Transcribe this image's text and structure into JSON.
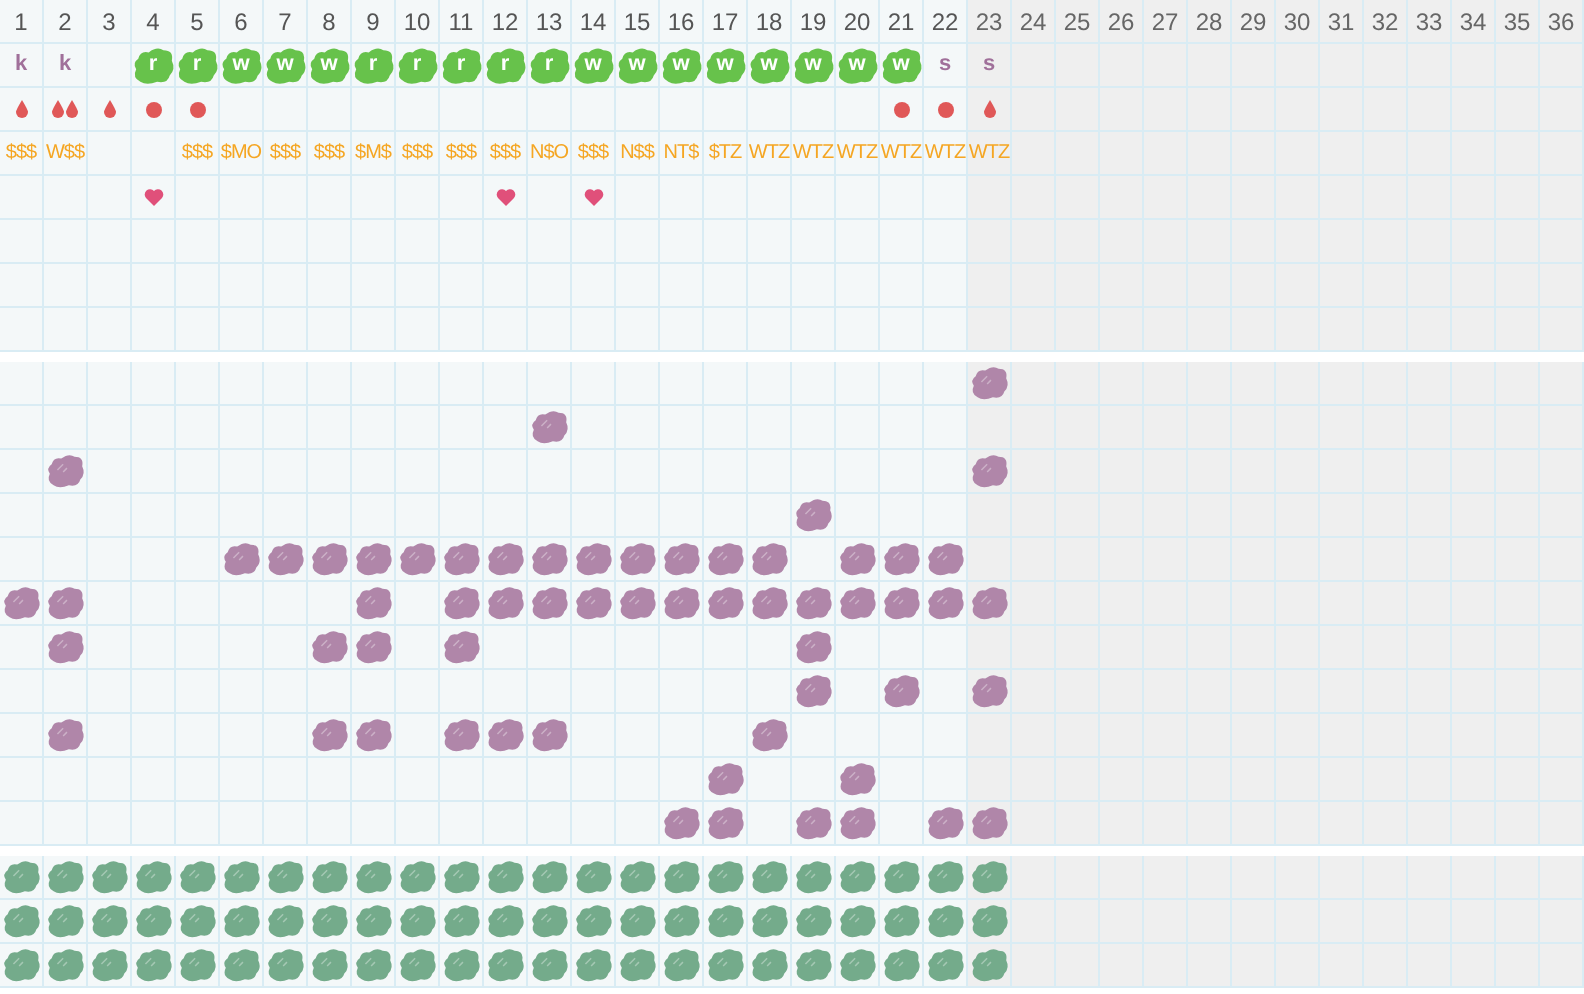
{
  "columns": [
    {
      "label": "1",
      "greyed": false
    },
    {
      "label": "2",
      "greyed": false
    },
    {
      "label": "3",
      "greyed": false
    },
    {
      "label": "4",
      "greyed": false
    },
    {
      "label": "5",
      "greyed": false
    },
    {
      "label": "6",
      "greyed": false
    },
    {
      "label": "7",
      "greyed": false
    },
    {
      "label": "8",
      "greyed": false
    },
    {
      "label": "9",
      "greyed": false
    },
    {
      "label": "10",
      "greyed": false
    },
    {
      "label": "11",
      "greyed": false
    },
    {
      "label": "12",
      "greyed": false
    },
    {
      "label": "13",
      "greyed": false
    },
    {
      "label": "14",
      "greyed": false
    },
    {
      "label": "15",
      "greyed": false
    },
    {
      "label": "16",
      "greyed": false
    },
    {
      "label": "17",
      "greyed": false
    },
    {
      "label": "18",
      "greyed": false
    },
    {
      "label": "19",
      "greyed": false
    },
    {
      "label": "20",
      "greyed": false
    },
    {
      "label": "21",
      "greyed": false
    },
    {
      "label": "22",
      "greyed": false
    },
    {
      "label": "23",
      "greyed": true
    },
    {
      "label": "24",
      "greyed": true
    },
    {
      "label": "25",
      "greyed": true
    },
    {
      "label": "26",
      "greyed": true
    },
    {
      "label": "27",
      "greyed": true
    },
    {
      "label": "28",
      "greyed": true
    },
    {
      "label": "29",
      "greyed": true
    },
    {
      "label": "30",
      "greyed": true
    },
    {
      "label": "31",
      "greyed": true
    },
    {
      "label": "32",
      "greyed": true
    },
    {
      "label": "33",
      "greyed": true
    },
    {
      "label": "34",
      "greyed": true
    },
    {
      "label": "35",
      "greyed": true
    },
    {
      "label": "36",
      "greyed": true
    }
  ],
  "tracks": [
    {
      "tag": {
        "text": "k",
        "kind": "plain"
      },
      "marker": {
        "kind": "drop"
      },
      "code": "$$$",
      "heart": false
    },
    {
      "tag": {
        "text": "k",
        "kind": "plain"
      },
      "marker": {
        "kind": "double_drop"
      },
      "code": "W$$",
      "heart": false
    },
    {
      "marker": {
        "kind": "drop"
      },
      "heart": false
    },
    {
      "tag": {
        "text": "r",
        "kind": "badge"
      },
      "marker": {
        "kind": "dot"
      },
      "heart": true
    },
    {
      "tag": {
        "text": "r",
        "kind": "badge"
      },
      "marker": {
        "kind": "dot"
      },
      "code": "$$$",
      "heart": false
    },
    {
      "tag": {
        "text": "w",
        "kind": "badge"
      },
      "code": "$MO",
      "heart": false
    },
    {
      "tag": {
        "text": "w",
        "kind": "badge"
      },
      "code": "$$$",
      "heart": false
    },
    {
      "tag": {
        "text": "w",
        "kind": "badge"
      },
      "code": "$$$",
      "heart": false
    },
    {
      "tag": {
        "text": "r",
        "kind": "badge"
      },
      "code": "$M$",
      "heart": false
    },
    {
      "tag": {
        "text": "r",
        "kind": "badge"
      },
      "code": "$$$",
      "heart": false
    },
    {
      "tag": {
        "text": "r",
        "kind": "badge"
      },
      "code": "$$$",
      "heart": false
    },
    {
      "tag": {
        "text": "r",
        "kind": "badge"
      },
      "code": "$$$",
      "heart": true
    },
    {
      "tag": {
        "text": "r",
        "kind": "badge"
      },
      "code": "N$O",
      "heart": false
    },
    {
      "tag": {
        "text": "w",
        "kind": "badge"
      },
      "code": "$$$",
      "heart": true
    },
    {
      "tag": {
        "text": "w",
        "kind": "badge"
      },
      "code": "N$$",
      "heart": false
    },
    {
      "tag": {
        "text": "w",
        "kind": "badge"
      },
      "code": "NT$",
      "heart": false
    },
    {
      "tag": {
        "text": "w",
        "kind": "badge"
      },
      "code": "$TZ",
      "heart": false
    },
    {
      "tag": {
        "text": "w",
        "kind": "badge"
      },
      "code": "WTZ",
      "heart": false
    },
    {
      "tag": {
        "text": "w",
        "kind": "badge"
      },
      "code": "WTZ",
      "heart": false
    },
    {
      "tag": {
        "text": "w",
        "kind": "badge"
      },
      "code": "WTZ",
      "heart": false
    },
    {
      "tag": {
        "text": "w",
        "kind": "badge"
      },
      "marker": {
        "kind": "dot"
      },
      "code": "WTZ",
      "heart": false
    },
    {
      "tag": {
        "text": "s",
        "kind": "plain"
      },
      "marker": {
        "kind": "dot"
      },
      "code": "WTZ",
      "heart": false
    },
    {
      "tag": {
        "text": "s",
        "kind": "plain"
      },
      "marker": {
        "kind": "drop"
      },
      "code": "WTZ",
      "heart": false
    }
  ],
  "middle_rows": [
    {
      "cells": [
        false,
        false,
        false,
        false,
        false,
        false,
        false,
        false,
        false,
        false,
        false,
        false,
        false,
        false,
        false,
        false,
        false,
        false,
        false,
        false,
        false,
        false,
        true
      ]
    },
    {
      "cells": [
        false,
        false,
        false,
        false,
        false,
        false,
        false,
        false,
        false,
        false,
        false,
        false,
        true,
        false,
        false,
        false,
        false,
        false,
        false,
        false,
        false,
        false,
        false
      ]
    },
    {
      "cells": [
        false,
        true,
        false,
        false,
        false,
        false,
        false,
        false,
        false,
        false,
        false,
        false,
        false,
        false,
        false,
        false,
        false,
        false,
        false,
        false,
        false,
        false,
        true
      ]
    },
    {
      "cells": [
        false,
        false,
        false,
        false,
        false,
        false,
        false,
        false,
        false,
        false,
        false,
        false,
        false,
        false,
        false,
        false,
        false,
        false,
        true,
        false,
        false,
        false,
        false
      ]
    },
    {
      "cells": [
        false,
        false,
        false,
        false,
        false,
        true,
        true,
        true,
        true,
        true,
        true,
        true,
        true,
        true,
        true,
        true,
        true,
        true,
        false,
        true,
        true,
        true,
        false
      ]
    },
    {
      "cells": [
        true,
        true,
        false,
        false,
        false,
        false,
        false,
        false,
        true,
        false,
        true,
        true,
        true,
        true,
        true,
        true,
        true,
        true,
        true,
        true,
        true,
        true,
        true
      ]
    },
    {
      "cells": [
        false,
        true,
        false,
        false,
        false,
        false,
        false,
        true,
        true,
        false,
        true,
        false,
        false,
        false,
        false,
        false,
        false,
        false,
        true,
        false,
        false,
        false,
        false
      ]
    },
    {
      "cells": [
        false,
        false,
        false,
        false,
        false,
        false,
        false,
        false,
        false,
        false,
        false,
        false,
        false,
        false,
        false,
        false,
        false,
        false,
        true,
        false,
        true,
        false,
        true
      ]
    },
    {
      "cells": [
        false,
        true,
        false,
        false,
        false,
        false,
        false,
        true,
        true,
        false,
        true,
        true,
        true,
        false,
        false,
        false,
        false,
        true,
        false,
        false,
        false,
        false,
        false
      ]
    },
    {
      "cells": [
        false,
        false,
        false,
        false,
        false,
        false,
        false,
        false,
        false,
        false,
        false,
        false,
        false,
        false,
        false,
        false,
        true,
        false,
        false,
        true,
        false,
        false,
        false
      ]
    },
    {
      "cells": [
        false,
        false,
        false,
        false,
        false,
        false,
        false,
        false,
        false,
        false,
        false,
        false,
        false,
        false,
        false,
        true,
        true,
        false,
        true,
        true,
        false,
        true,
        true
      ]
    }
  ],
  "bottom_rows": [
    {
      "cells": [
        true,
        true,
        true,
        true,
        true,
        true,
        true,
        true,
        true,
        true,
        true,
        true,
        true,
        true,
        true,
        true,
        true,
        true,
        true,
        true,
        true,
        true,
        true
      ]
    },
    {
      "cells": [
        true,
        true,
        true,
        true,
        true,
        true,
        true,
        true,
        true,
        true,
        true,
        true,
        true,
        true,
        true,
        true,
        true,
        true,
        true,
        true,
        true,
        true,
        true
      ]
    },
    {
      "cells": [
        true,
        true,
        true,
        true,
        true,
        true,
        true,
        true,
        true,
        true,
        true,
        true,
        true,
        true,
        true,
        true,
        true,
        true,
        true,
        true,
        true,
        true,
        true
      ]
    }
  ]
}
